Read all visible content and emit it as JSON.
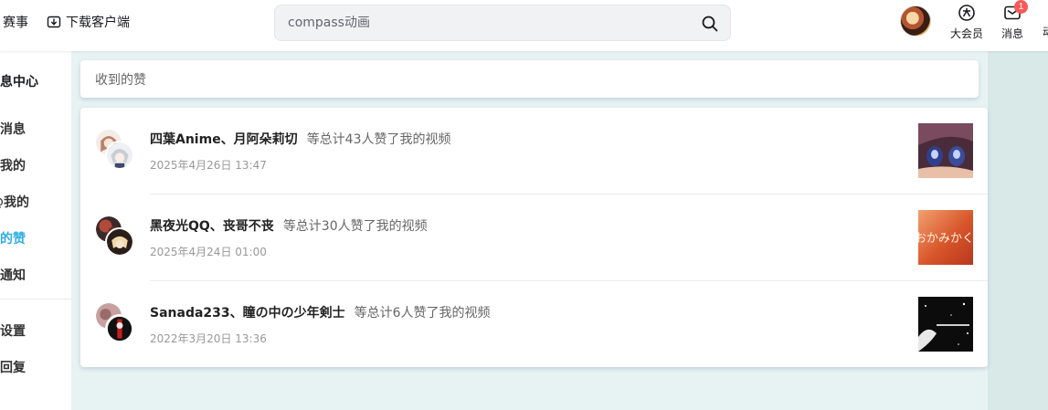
{
  "header": {
    "nav": [
      {
        "label": "赛事"
      },
      {
        "label": "下载客户端"
      }
    ],
    "search": {
      "placeholder": "compass动画"
    },
    "items": [
      {
        "label": "大会员"
      },
      {
        "label": "消息",
        "badge": "1"
      }
    ],
    "cut_label": "动"
  },
  "sidebar": {
    "title": "消息中心",
    "items": [
      {
        "label": "我的消息"
      },
      {
        "label": "回复我的"
      },
      {
        "label": "@我的"
      },
      {
        "label": "收到的赞",
        "active": true
      },
      {
        "label": "系统通知"
      },
      {
        "label": "消息设置"
      },
      {
        "label": "自动回复"
      }
    ]
  },
  "main": {
    "title": "收到的赞",
    "likes": [
      {
        "names": "四葉Anime、月阿朵莉切",
        "desc": "等总计43人赞了我的视频",
        "date": "2025年4月26日 13:47"
      },
      {
        "names": "黑夜光QQ、丧哥不丧",
        "desc": "等总计30人赞了我的视频",
        "date": "2025年4月24日 01:00"
      },
      {
        "names": "Sanada233、瞳の中の少年剣士",
        "desc": "等总计6人赞了我的视频",
        "date": "2022年3月20日 13:36"
      }
    ],
    "thumb_text": "おかみかく"
  },
  "colors": {
    "accent": "#2faee3",
    "badge": "#fa5a57",
    "page_bg": "#e7f2f2"
  }
}
